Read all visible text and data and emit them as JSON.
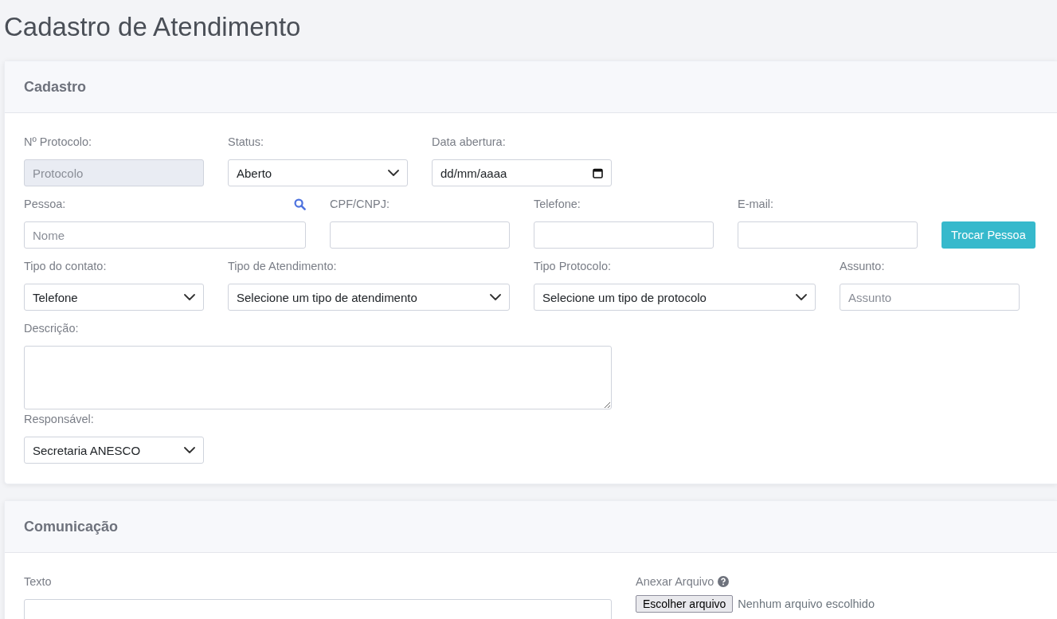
{
  "page_title": "Cadastro de Atendimento",
  "cards": [
    {
      "title": "Cadastro",
      "fields": [
        {
          "kind": "input",
          "label": "Nº Protocolo:",
          "placeholder": "Protocolo",
          "disabled": true
        },
        {
          "kind": "select",
          "label": "Status:",
          "value": "Aberto"
        },
        {
          "kind": "date",
          "label": "Data abertura:",
          "value": "dd/mm/aaaa"
        },
        {
          "kind": "input",
          "label": "Pessoa:",
          "placeholder": "Nome",
          "disabled": false,
          "search": true
        },
        {
          "kind": "input",
          "label": "CPF/CNPJ:",
          "disabled": false
        },
        {
          "kind": "input",
          "label": "Telefone:",
          "disabled": false
        },
        {
          "kind": "input",
          "label": "E-mail:",
          "disabled": false
        },
        {
          "kind": "button",
          "text": "Trocar Pessoa"
        },
        {
          "kind": "select",
          "label": "Tipo do contato:",
          "value": "Telefone"
        },
        {
          "kind": "select",
          "label": "Tipo de Atendimento:",
          "value": "Selecione um tipo de atendimento"
        },
        {
          "kind": "select",
          "label": "Tipo Protocolo:",
          "value": "Selecione um tipo de protocolo"
        },
        {
          "kind": "input",
          "label": "Assunto:",
          "placeholder": "Assunto",
          "disabled": false
        },
        {
          "kind": "textarea",
          "label": "Descrição:"
        },
        {
          "kind": "select",
          "label": "Responsável:",
          "value": "Secretaria ANESCO"
        }
      ]
    },
    {
      "title": "Comunicação",
      "fields": [
        {
          "kind": "textarea",
          "label": "Texto"
        },
        {
          "kind": "file",
          "label": "Anexar Arquivo",
          "help": true,
          "button": "Escolher arquivo",
          "status": "Nenhum arquivo escolhido"
        }
      ]
    }
  ]
}
